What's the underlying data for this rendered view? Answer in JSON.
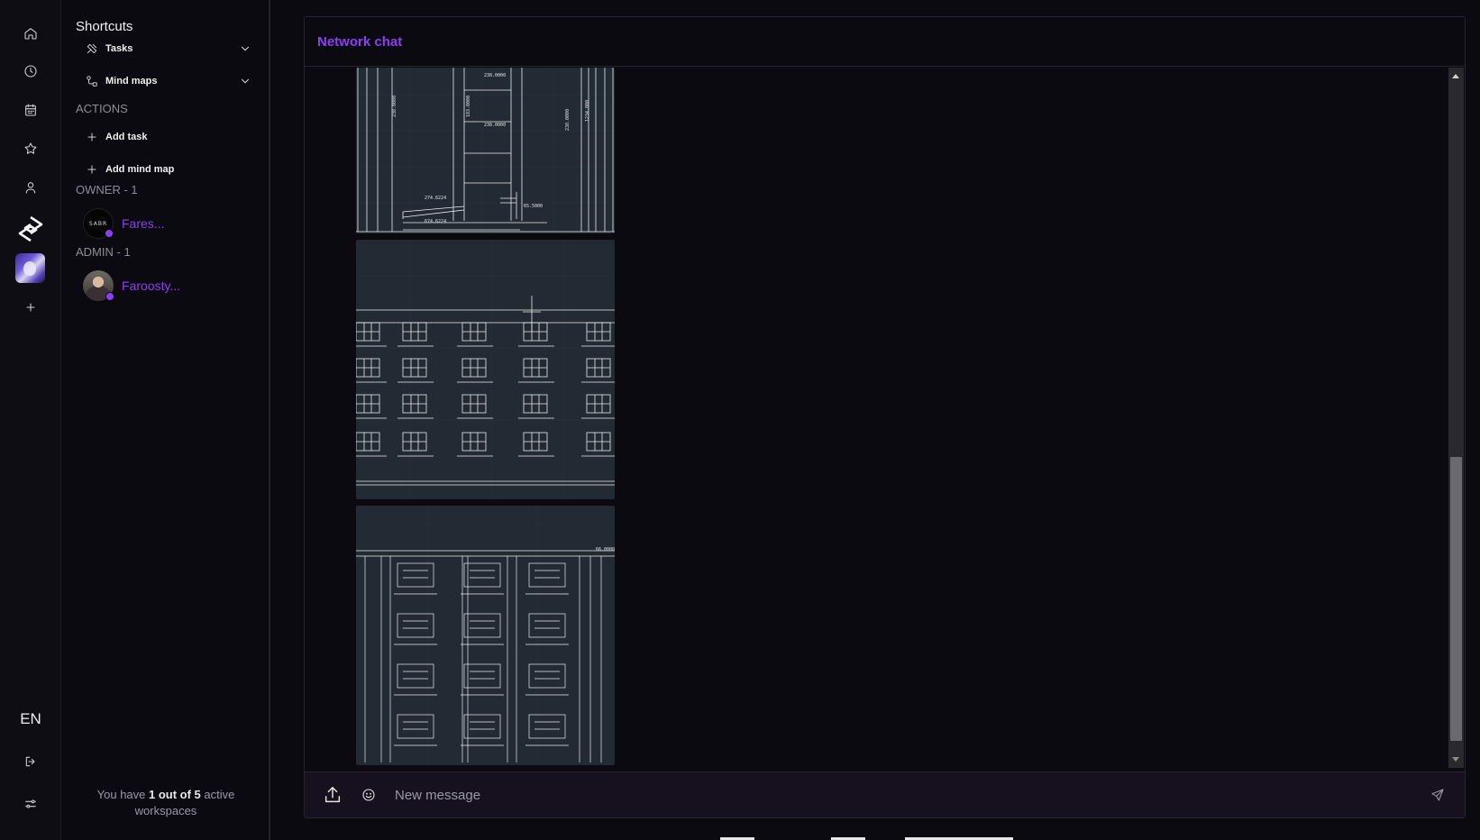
{
  "rail": {
    "icons": [
      "home-icon",
      "clock-icon",
      "calendar-icon",
      "star-icon",
      "user-icon"
    ],
    "workspaces": [
      "workspace-logo",
      "workspace-avatar"
    ],
    "add_icon": "plus-icon",
    "language": "EN",
    "bottom_icons": [
      "logout-icon",
      "settings-sliders-icon"
    ]
  },
  "sidebar": {
    "shortcuts_title": "Shortcuts",
    "shortcuts": [
      {
        "label": "Tasks",
        "icon": "tasks-icon"
      },
      {
        "label": "Mind maps",
        "icon": "mind-map-icon"
      }
    ],
    "actions_title": "ACTIONS",
    "actions": [
      {
        "label": "Add task",
        "icon": "plus-icon"
      },
      {
        "label": "Add mind map",
        "icon": "plus-icon"
      }
    ],
    "owner_section": "OWNER - 1",
    "owner": {
      "name": "Fares...",
      "avatar_text": "SABR",
      "status_color": "#8b3ff0"
    },
    "admin_section": "ADMIN - 1",
    "admin": {
      "name": "Faroosty...",
      "status_color": "#8b3ff0"
    },
    "footer": {
      "prefix": "You have ",
      "count": "1 out of 5",
      "suffix": " active workspaces"
    }
  },
  "chat": {
    "title": "Network chat",
    "attachments": [
      "cad-drawing-elevation",
      "cad-drawing-facade",
      "cad-drawing-plan"
    ],
    "composer": {
      "placeholder": "New message"
    }
  },
  "colors": {
    "accent": "#8b3ff0",
    "background": "#0b0a10",
    "composer_bg": "#16101f"
  }
}
